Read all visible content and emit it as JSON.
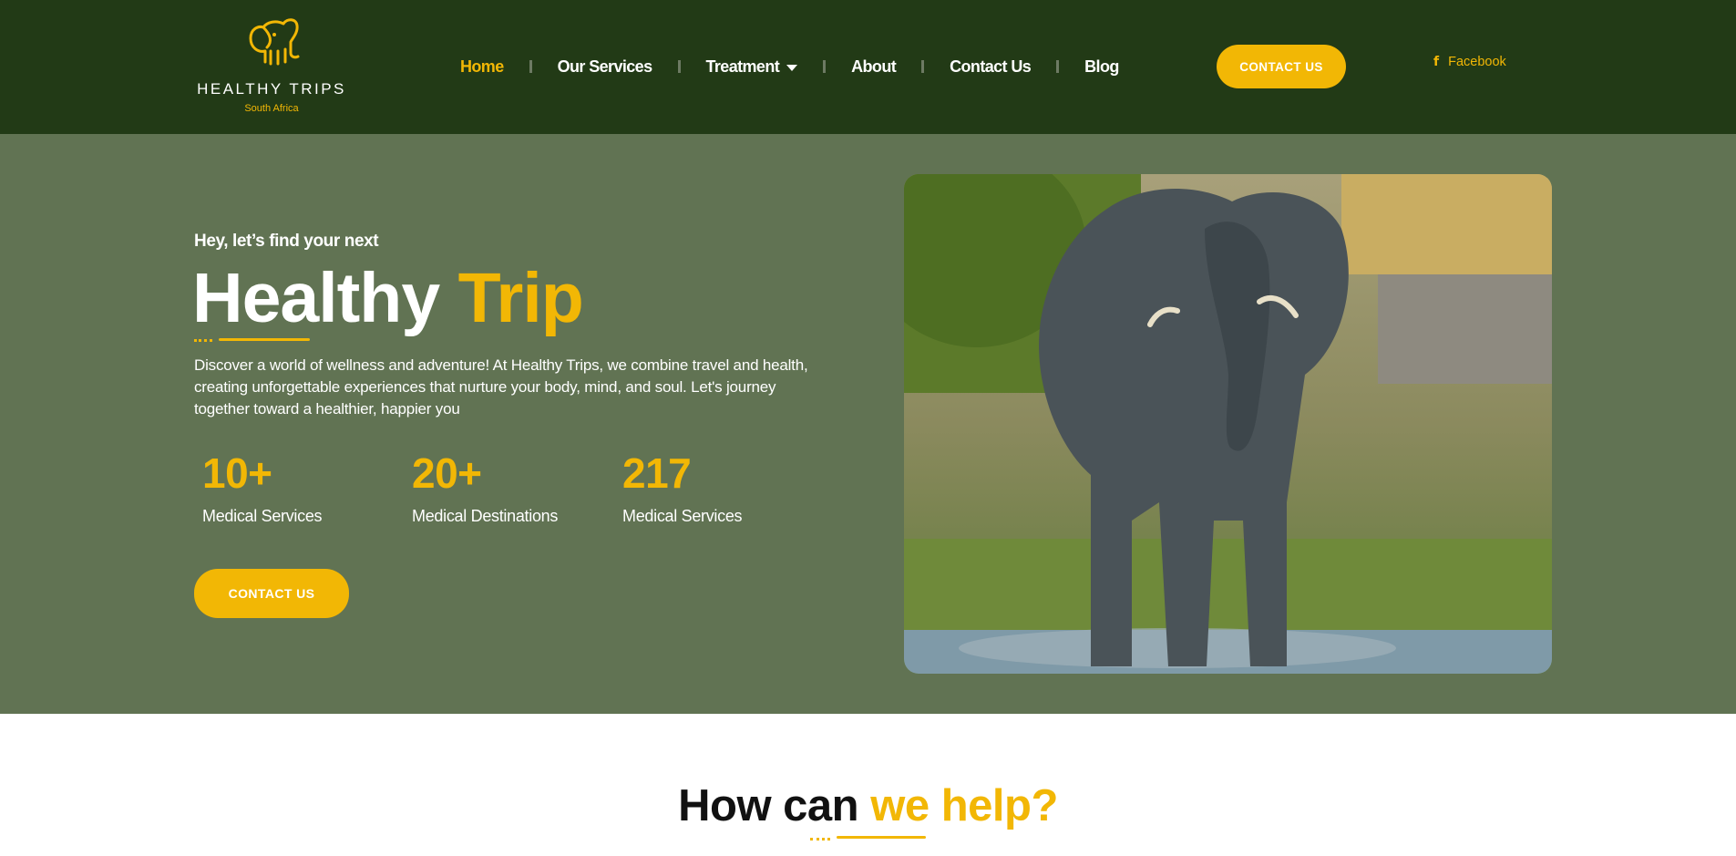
{
  "header": {
    "logo": {
      "name": "HEALTHY TRIPS",
      "tagline": "South Africa",
      "icon": "elephant-icon"
    },
    "nav": [
      {
        "label": "Home",
        "active": true
      },
      {
        "label": "Our Services"
      },
      {
        "label": "Treatment",
        "has_dropdown": true
      },
      {
        "label": "About"
      },
      {
        "label": "Contact Us"
      },
      {
        "label": "Blog"
      }
    ],
    "cta_label": "CONTACT US",
    "social": {
      "label": "Facebook",
      "icon": "facebook-icon"
    }
  },
  "hero": {
    "eyebrow": "Hey, let’s find your next",
    "title_main": "Healthy",
    "title_accent": "Trip",
    "description": "Discover a world of wellness and adventure! At Healthy Trips, we combine travel and health, creating unforgettable experiences that nurture your body, mind, and soul. Let's journey together toward a healthier, happier you",
    "stats": [
      {
        "value": "10+",
        "label": "Medical Services"
      },
      {
        "value": "20+",
        "label": "Medical Destinations"
      },
      {
        "value": "217",
        "label": "Medical Services"
      }
    ],
    "cta_label": "CONTACT US",
    "image": "elephant-photo"
  },
  "help": {
    "title_dark": "How can",
    "title_accent": "we help?"
  },
  "colors": {
    "header_bg": "#223a16",
    "hero_bg": "#617353",
    "accent": "#f2b705"
  }
}
